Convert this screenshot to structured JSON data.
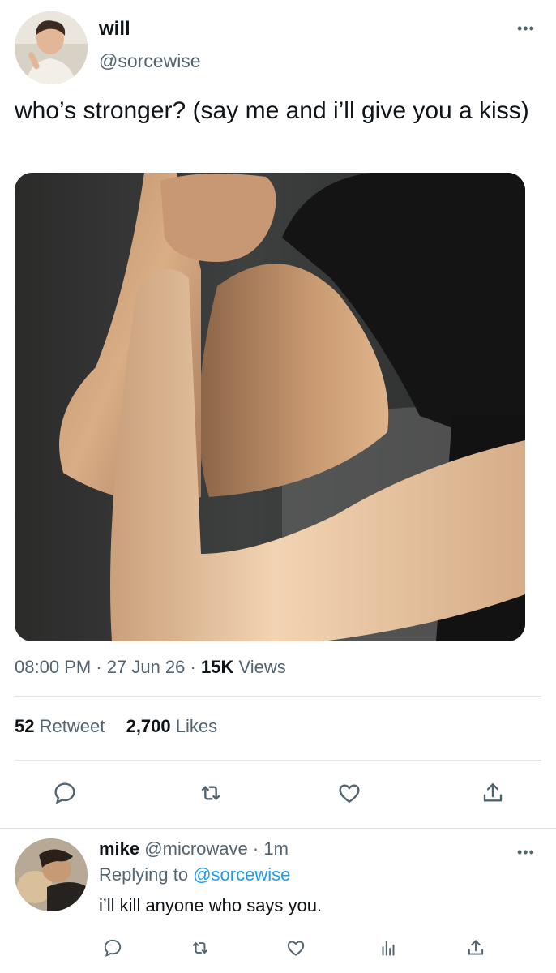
{
  "tweet": {
    "author_name": "will",
    "author_handle": "@sorcewise",
    "more": "•••",
    "text": "who’s stronger? (say me and i’ll give you a kiss)",
    "time": "08:00 PM",
    "date": "27 Jun 26",
    "dot": "·",
    "views_count": "15K",
    "views_label": "Views",
    "retweets_count": "52",
    "retweets_label": "Retweet",
    "likes_count": "2,700",
    "likes_label": "Likes"
  },
  "reply": {
    "author_name": "mike",
    "author_handle": "@microwave",
    "dot": "·",
    "age": "1m",
    "more": "•••",
    "replying_prefix": "Replying to",
    "replying_handle": "@sorcewise",
    "text": "i’ll kill anyone who says you."
  },
  "icons": {
    "reply": "reply-icon",
    "retweet": "retweet-icon",
    "like": "heart-icon",
    "share": "share-icon",
    "views": "views-icon"
  },
  "colors": {
    "text": "#0f1419",
    "muted": "#536471",
    "link": "#1d9bf0",
    "divider": "#e1e5e8"
  }
}
